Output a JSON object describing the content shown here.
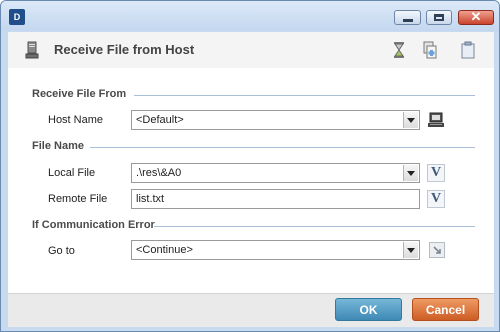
{
  "window": {
    "app_icon_text": "D",
    "icons": [
      "app-icon",
      "minimize-icon",
      "maximize-icon",
      "close-icon"
    ]
  },
  "header": {
    "title": "Receive File from Host",
    "icons": [
      "host-computer-icon",
      "hourglass-icon",
      "copy-icon",
      "clipboard-icon"
    ]
  },
  "sections": {
    "receive_from": {
      "label": "Receive File From",
      "host_name_label": "Host Name",
      "host_name_value": "<Default>",
      "host_button_icon": "host-computer-icon"
    },
    "file_name": {
      "label": "File Name",
      "local_file_label": "Local File",
      "local_file_value": ".\\res\\&A0",
      "local_var_button": "V",
      "remote_file_label": "Remote File",
      "remote_file_value": "list.txt",
      "remote_var_button": "V"
    },
    "comm_error": {
      "label": "If Communication Error",
      "goto_label": "Go to",
      "goto_value": "<Continue>",
      "goto_button_icon": "jump-arrow-icon"
    }
  },
  "footer": {
    "ok_label": "OK",
    "cancel_label": "Cancel"
  },
  "colors": {
    "ok_button": "#4a95c0",
    "cancel_button": "#d9692f",
    "section_line": "#a9bed8",
    "window_frame": "#c7daf0"
  }
}
